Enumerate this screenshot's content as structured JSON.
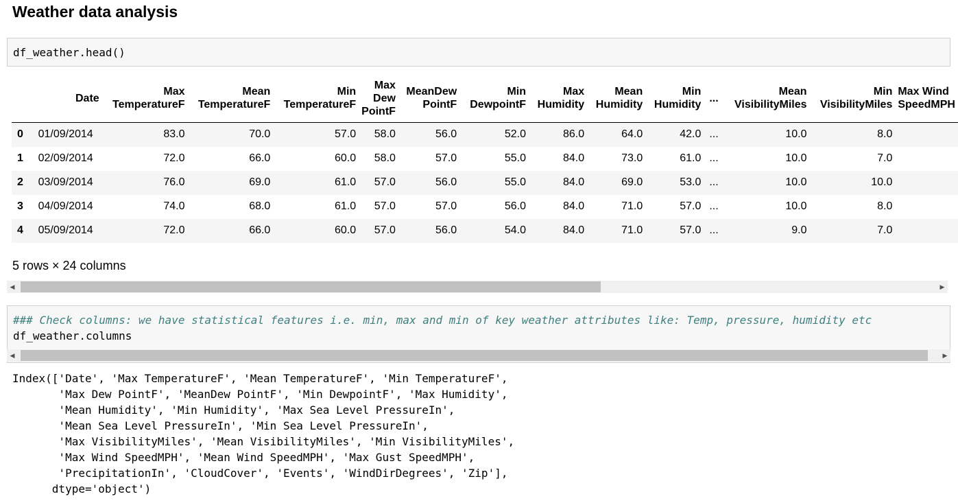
{
  "heading": "Weather data analysis",
  "cell1": {
    "code": "df_weather.head()"
  },
  "table": {
    "columns": [
      "Date",
      "Max TemperatureF",
      "Mean TemperatureF",
      "Min TemperatureF",
      "Max Dew PointF",
      "MeanDew PointF",
      "Min DewpointF",
      "Max Humidity",
      "Mean Humidity",
      "Min Humidity",
      "...",
      "Mean VisibilityMiles",
      "Min VisibilityMiles",
      "Max Wind SpeedMPH"
    ],
    "rows": [
      [
        "0",
        "01/09/2014",
        "83.0",
        "70.0",
        "57.0",
        "58.0",
        "56.0",
        "52.0",
        "86.0",
        "64.0",
        "42.0",
        "...",
        "10.0",
        "8.0",
        ""
      ],
      [
        "1",
        "02/09/2014",
        "72.0",
        "66.0",
        "60.0",
        "58.0",
        "57.0",
        "55.0",
        "84.0",
        "73.0",
        "61.0",
        "...",
        "10.0",
        "7.0",
        ""
      ],
      [
        "2",
        "03/09/2014",
        "76.0",
        "69.0",
        "61.0",
        "57.0",
        "56.0",
        "55.0",
        "84.0",
        "69.0",
        "53.0",
        "...",
        "10.0",
        "10.0",
        ""
      ],
      [
        "3",
        "04/09/2014",
        "74.0",
        "68.0",
        "61.0",
        "57.0",
        "57.0",
        "56.0",
        "84.0",
        "71.0",
        "57.0",
        "...",
        "10.0",
        "8.0",
        ""
      ],
      [
        "4",
        "05/09/2014",
        "72.0",
        "66.0",
        "60.0",
        "57.0",
        "56.0",
        "54.0",
        "84.0",
        "71.0",
        "57.0",
        "...",
        "9.0",
        "7.0",
        ""
      ]
    ]
  },
  "rows_info": "5 rows × 24 columns",
  "cell2": {
    "comment": "### Check columns: we have statistical features i.e. min, max and min of key weather attributes like: Temp, pressure, humidity etc",
    "code": "df_weather.columns"
  },
  "output": {
    "lines": [
      "Index(['Date', 'Max TemperatureF', 'Mean TemperatureF', 'Min TemperatureF',",
      "       'Max Dew PointF', 'MeanDew PointF', 'Min DewpointF', 'Max Humidity',",
      "       'Mean Humidity', 'Min Humidity', 'Max Sea Level PressureIn',",
      "       'Mean Sea Level PressureIn', 'Min Sea Level PressureIn',",
      "       'Max VisibilityMiles', 'Mean VisibilityMiles', 'Min VisibilityMiles',",
      "       'Max Wind SpeedMPH', 'Mean Wind SpeedMPH', 'Max Gust SpeedMPH',",
      "       'PrecipitationIn', 'CloudCover', 'Events', 'WindDirDegrees', 'Zip'],",
      "      dtype='object')"
    ]
  },
  "scrollbars": {
    "left_arrow": "◀",
    "right_arrow": "▶"
  }
}
